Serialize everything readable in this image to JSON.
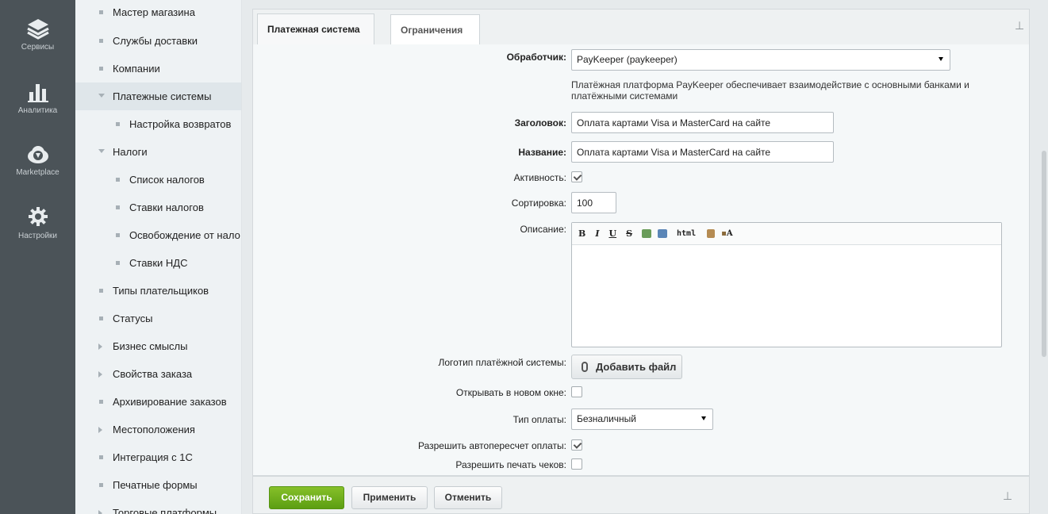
{
  "leftbar": {
    "items": [
      {
        "label": "Сервисы",
        "icon": "stack-layers-icon"
      },
      {
        "label": "Аналитика",
        "icon": "bar-chart-icon"
      },
      {
        "label": "Marketplace",
        "icon": "cloud-download-icon"
      },
      {
        "label": "Настройки",
        "icon": "gear-icon"
      }
    ]
  },
  "menu": {
    "items": [
      {
        "label": "Мастер магазина",
        "marker": "bullet"
      },
      {
        "label": "Службы доставки",
        "marker": "bullet"
      },
      {
        "label": "Компании",
        "marker": "bullet"
      },
      {
        "label": "Платежные системы",
        "marker": "arrow-down",
        "selected": true
      },
      {
        "label": "Настройка возвратов",
        "marker": "bullet"
      },
      {
        "label": "Налоги",
        "marker": "arrow-down"
      },
      {
        "label": "Список налогов",
        "marker": "bullet"
      },
      {
        "label": "Ставки налогов",
        "marker": "bullet"
      },
      {
        "label": "Освобождение от нало",
        "marker": "bullet"
      },
      {
        "label": "Ставки НДС",
        "marker": "bullet"
      },
      {
        "label": "Типы плательщиков",
        "marker": "bullet"
      },
      {
        "label": "Статусы",
        "marker": "bullet"
      },
      {
        "label": "Бизнес смыслы",
        "marker": "arrow-right"
      },
      {
        "label": "Свойства заказа",
        "marker": "arrow-right"
      },
      {
        "label": "Архивирование заказов",
        "marker": "bullet"
      },
      {
        "label": "Местоположения",
        "marker": "arrow-right"
      },
      {
        "label": "Интеграция с 1С",
        "marker": "bullet"
      },
      {
        "label": "Печатные формы",
        "marker": "bullet"
      },
      {
        "label": "Торговые платформы",
        "marker": "arrow-right"
      }
    ]
  },
  "tabs": [
    {
      "label": "Платежная система",
      "active": true
    },
    {
      "label": "Ограничения",
      "active": false
    }
  ],
  "form": {
    "handler_label": "Обработчик:",
    "handler_value": "PayKeeper (paykeeper)",
    "handler_desc": "Платёжная платформа PayKeeper обеспечивает взаимодействие с основными банками и платёжными системами",
    "header_label": "Заголовок:",
    "header_value": "Оплата картами Visa и MasterCard на сайте",
    "name_label": "Название:",
    "name_value": "Оплата картами Visa и MasterCard на сайте",
    "active_label": "Активность:",
    "active_checked": true,
    "sort_label": "Сортировка:",
    "sort_value": "100",
    "desc_label": "Описание:",
    "editor_buttons": {
      "bold": "B",
      "italic": "I",
      "underline": "U",
      "strike": "S",
      "html": "html",
      "fmt": "A"
    },
    "logo_label": "Логотип платёжной системы:",
    "add_file": "Добавить файл",
    "new_window_label": "Открывать в новом окне:",
    "new_window_checked": false,
    "pay_type_label": "Тип оплаты:",
    "pay_type_value": "Безналичный",
    "autorecalc_label": "Разрешить автопересчет оплаты:",
    "autorecalc_checked": true,
    "print_label": "Разрешить печать чеков:",
    "print_checked": false
  },
  "buttons": {
    "save": "Сохранить",
    "apply": "Применить",
    "cancel": "Отменить"
  },
  "colors": {
    "leftbar": "#4b5358",
    "save_green": "#6aaa1a",
    "menu_bg": "#eef2f4"
  }
}
